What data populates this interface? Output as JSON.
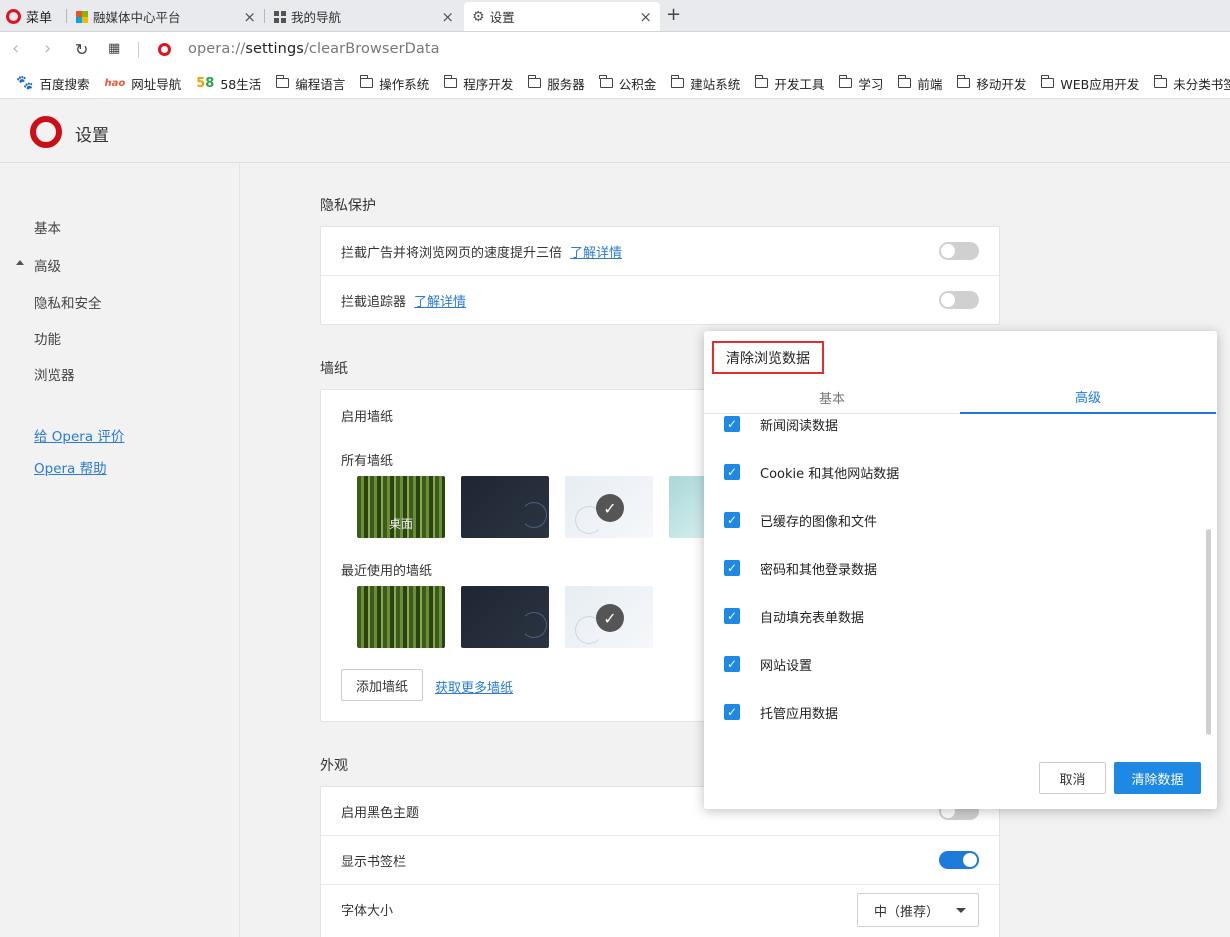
{
  "colors": {
    "accent": "#1e88e5",
    "opera_red": "#e0141e",
    "highlight_border": "#e0302e"
  },
  "tabs": {
    "menu_label": "菜单",
    "items": [
      {
        "label": "融媒体中心平台",
        "icon": "windows-logo-icon"
      },
      {
        "label": "我的导航",
        "icon": "grid-icon"
      },
      {
        "label": "设置",
        "icon": "gear-icon",
        "active": true
      }
    ],
    "new_tab": "+",
    "close": "×"
  },
  "address": {
    "url_scheme": "opera://",
    "url_path": "settings",
    "url_rest": "/clearBrowserData"
  },
  "bookmarks": [
    "百度搜索",
    "网址导航",
    "58生活",
    "编程语言",
    "操作系统",
    "程序开发",
    "服务器",
    "公积金",
    "建站系统",
    "开发工具",
    "学习",
    "前端",
    "移动开发",
    "WEB应用开发",
    "未分类书签"
  ],
  "header": {
    "title": "设置"
  },
  "sidebar": {
    "items": [
      "基本",
      "高级",
      "隐私和安全",
      "功能",
      "浏览器"
    ],
    "links": [
      "给 Opera 评价",
      "Opera 帮助"
    ]
  },
  "main": {
    "privacy": {
      "title": "隐私保护",
      "rows": [
        {
          "label": "拦截广告并将浏览网页的速度提升三倍",
          "link": "了解详情"
        },
        {
          "label": "拦截追踪器",
          "link": "了解详情"
        }
      ]
    },
    "wallpaper": {
      "title": "墙纸",
      "enable": "启用墙纸",
      "all": "所有墙纸",
      "desktop": "桌面",
      "recent": "最近使用的墙纸",
      "add": "添加墙纸",
      "more": "获取更多墙纸"
    },
    "appearance": {
      "title": "外观",
      "dark_theme": "启用黑色主题",
      "show_bookmarks": "显示书签栏",
      "font_size": "字体大小",
      "font_size_value": "中（推荐）"
    }
  },
  "dialog": {
    "title": "清除浏览数据",
    "tabs": [
      "基本",
      "高级"
    ],
    "options": [
      "新闻阅读数据",
      "Cookie 和其他网站数据",
      "已缓存的图像和文件",
      "密码和其他登录数据",
      "自动填充表单数据",
      "网站设置",
      "托管应用数据"
    ],
    "cancel": "取消",
    "clear": "清除数据"
  }
}
